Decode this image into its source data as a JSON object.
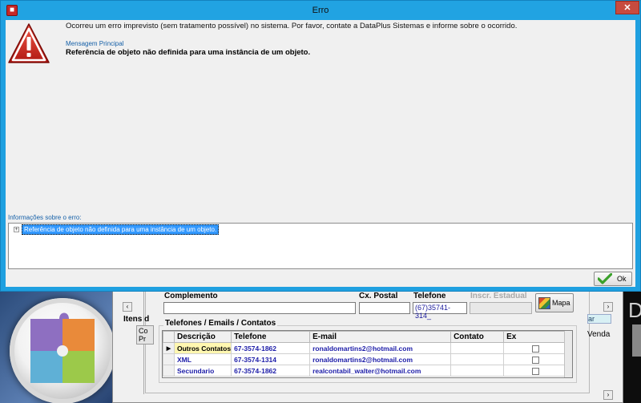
{
  "dialog": {
    "title": "Erro",
    "close_symbol": "✕",
    "app_icon": "error-app-icon",
    "message": "Ocorreu um erro imprevisto (sem tratamento possível) no sistema. Por favor, contate a DataPlus Sistemas e informe sobre o ocorrido.",
    "main_message_heading": "Mensagem Principal",
    "main_message": "Referência de objeto não definida para uma instância de um objeto.",
    "info_label": "Informações sobre o erro:",
    "tree_expand": "+",
    "tree_item": "Referência de objeto não definida para uma instância de um objeto.",
    "ok_label": "Ok",
    "accent_color": "#21a3e2"
  },
  "background_form": {
    "itens_label": "Itens d",
    "side_texts": [
      "Co",
      "Pr"
    ],
    "complemento_label": "Complemento",
    "cx_postal_label": "Cx. Postal",
    "telefone_label": "Telefone",
    "telefone_value": "(67)35741-314_",
    "inscr_estadual_label": "Inscr. Estadual",
    "mapa_label": "Mapa",
    "group_title": "Telefones / Emails / Contatos",
    "side_cyan": "ar",
    "side_venda": "Venda",
    "grid": {
      "columns": [
        "Descrição",
        "Telefone",
        "E-mail",
        "Contato",
        "Ex"
      ],
      "rows": [
        {
          "descricao": "Outros Contatos",
          "telefone": "67-3574-1862",
          "email": "ronaldomartins2@hotmail.com",
          "contato": "",
          "selected": true
        },
        {
          "descricao": "XML",
          "telefone": "67-3574-1314",
          "email": "ronaldomartins2@hotmail.com",
          "contato": "",
          "selected": false
        },
        {
          "descricao": "Secundario",
          "telefone": "67-3574-1862",
          "email": "realcontabil_walter@hotmail.com",
          "contato": "",
          "selected": false
        }
      ]
    }
  },
  "desktop": {
    "right_letter": "D"
  }
}
